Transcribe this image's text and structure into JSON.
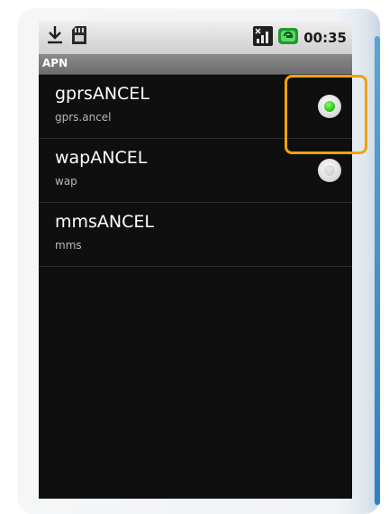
{
  "status_bar": {
    "time": "00:35",
    "icons": [
      "download-icon",
      "sd-card-icon",
      "signal-icon",
      "battery-charging-icon"
    ]
  },
  "title_bar": {
    "title": "APN"
  },
  "apn_list": [
    {
      "name": "gprsANCEL",
      "apn": "gprs.ancel",
      "selected": true
    },
    {
      "name": "wapANCEL",
      "apn": "wap",
      "selected": false
    },
    {
      "name": "mmsANCEL",
      "apn": "mms",
      "selected": false
    }
  ],
  "colors": {
    "highlight_border": "#f2a20a",
    "radio_selected": "#33cc1f",
    "screen_background": "#0f0f0f"
  }
}
